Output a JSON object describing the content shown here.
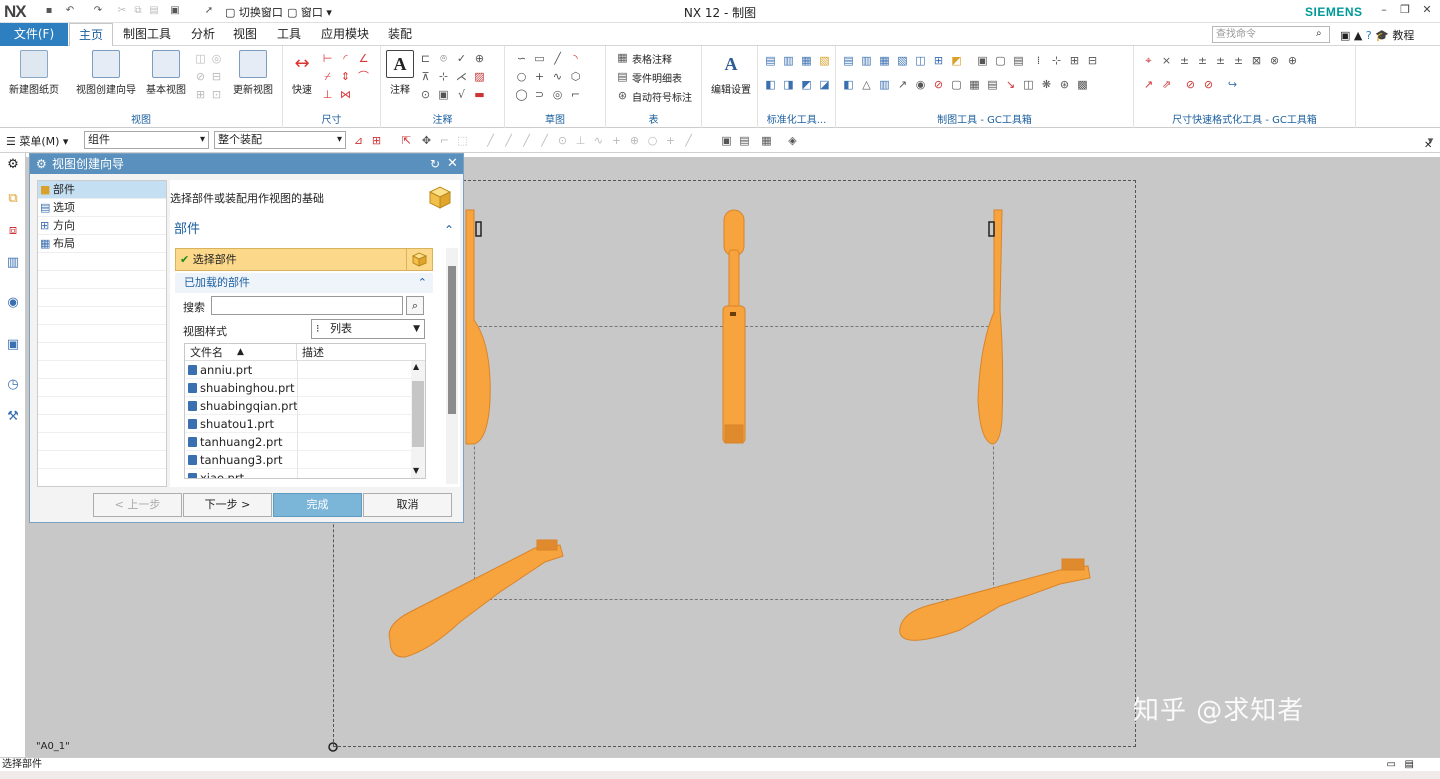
{
  "titlebar": {
    "logo": "NX",
    "title": "NX 12 - 制图",
    "brand": "SIEMENS",
    "switch_window": "切换窗口",
    "window_menu": "窗口"
  },
  "menu": {
    "file": "文件(F)",
    "tabs": [
      "主页",
      "制图工具",
      "分析",
      "视图",
      "工具",
      "应用模块",
      "装配"
    ],
    "active_tab": "主页",
    "search_placeholder": "查找命令",
    "tutorial": "教程"
  },
  "ribbon": {
    "new_sheet": "新建图纸页",
    "view_wizard": "视图创建向导",
    "base_view": "基本视图",
    "update_view": "更新视图",
    "group_view": "视图",
    "quick": "快速",
    "group_dim": "尺寸",
    "note": "注释",
    "group_note": "注释",
    "group_sketch": "草图",
    "table_note": "表格注释",
    "parts_list": "零件明细表",
    "auto_balloon": "自动符号标注",
    "group_table": "表",
    "edit_settings": "编辑设置",
    "group_std": "标准化工具...",
    "group_gc": "制图工具 - GC工具箱",
    "group_dimfmt": "尺寸快速格式化工具 - GC工具箱"
  },
  "toolbar2": {
    "menu": "菜单(M)",
    "filter": "组件",
    "scope": "整个装配"
  },
  "dialog": {
    "title": "视图创建向导",
    "tree": [
      "部件",
      "选项",
      "方向",
      "布局"
    ],
    "instruction": "选择部件或装配用作视图的基础",
    "section": "部件",
    "select_part": "选择部件",
    "loaded_parts": "已加载的部件",
    "search_label": "搜索",
    "view_style_label": "视图样式",
    "view_style_value": "列表",
    "col_filename": "文件名",
    "col_desc": "描述",
    "files": [
      "anniu.prt",
      "shuabinghou.prt",
      "shuabingqian.prt",
      "shuatou1.prt",
      "tanhuang2.prt",
      "tanhuang3.prt",
      "xiao.prt"
    ],
    "btn_back": "< 上一步",
    "btn_next": "下一步 >",
    "btn_finish": "完成",
    "btn_cancel": "取消"
  },
  "sheet_name": "\"A0_1\"",
  "watermark": "知乎 @求知者",
  "status": "选择部件",
  "colors": {
    "accent": "#2e7fbf",
    "part": "#f7a43e",
    "highlight": "#fcd98a"
  }
}
